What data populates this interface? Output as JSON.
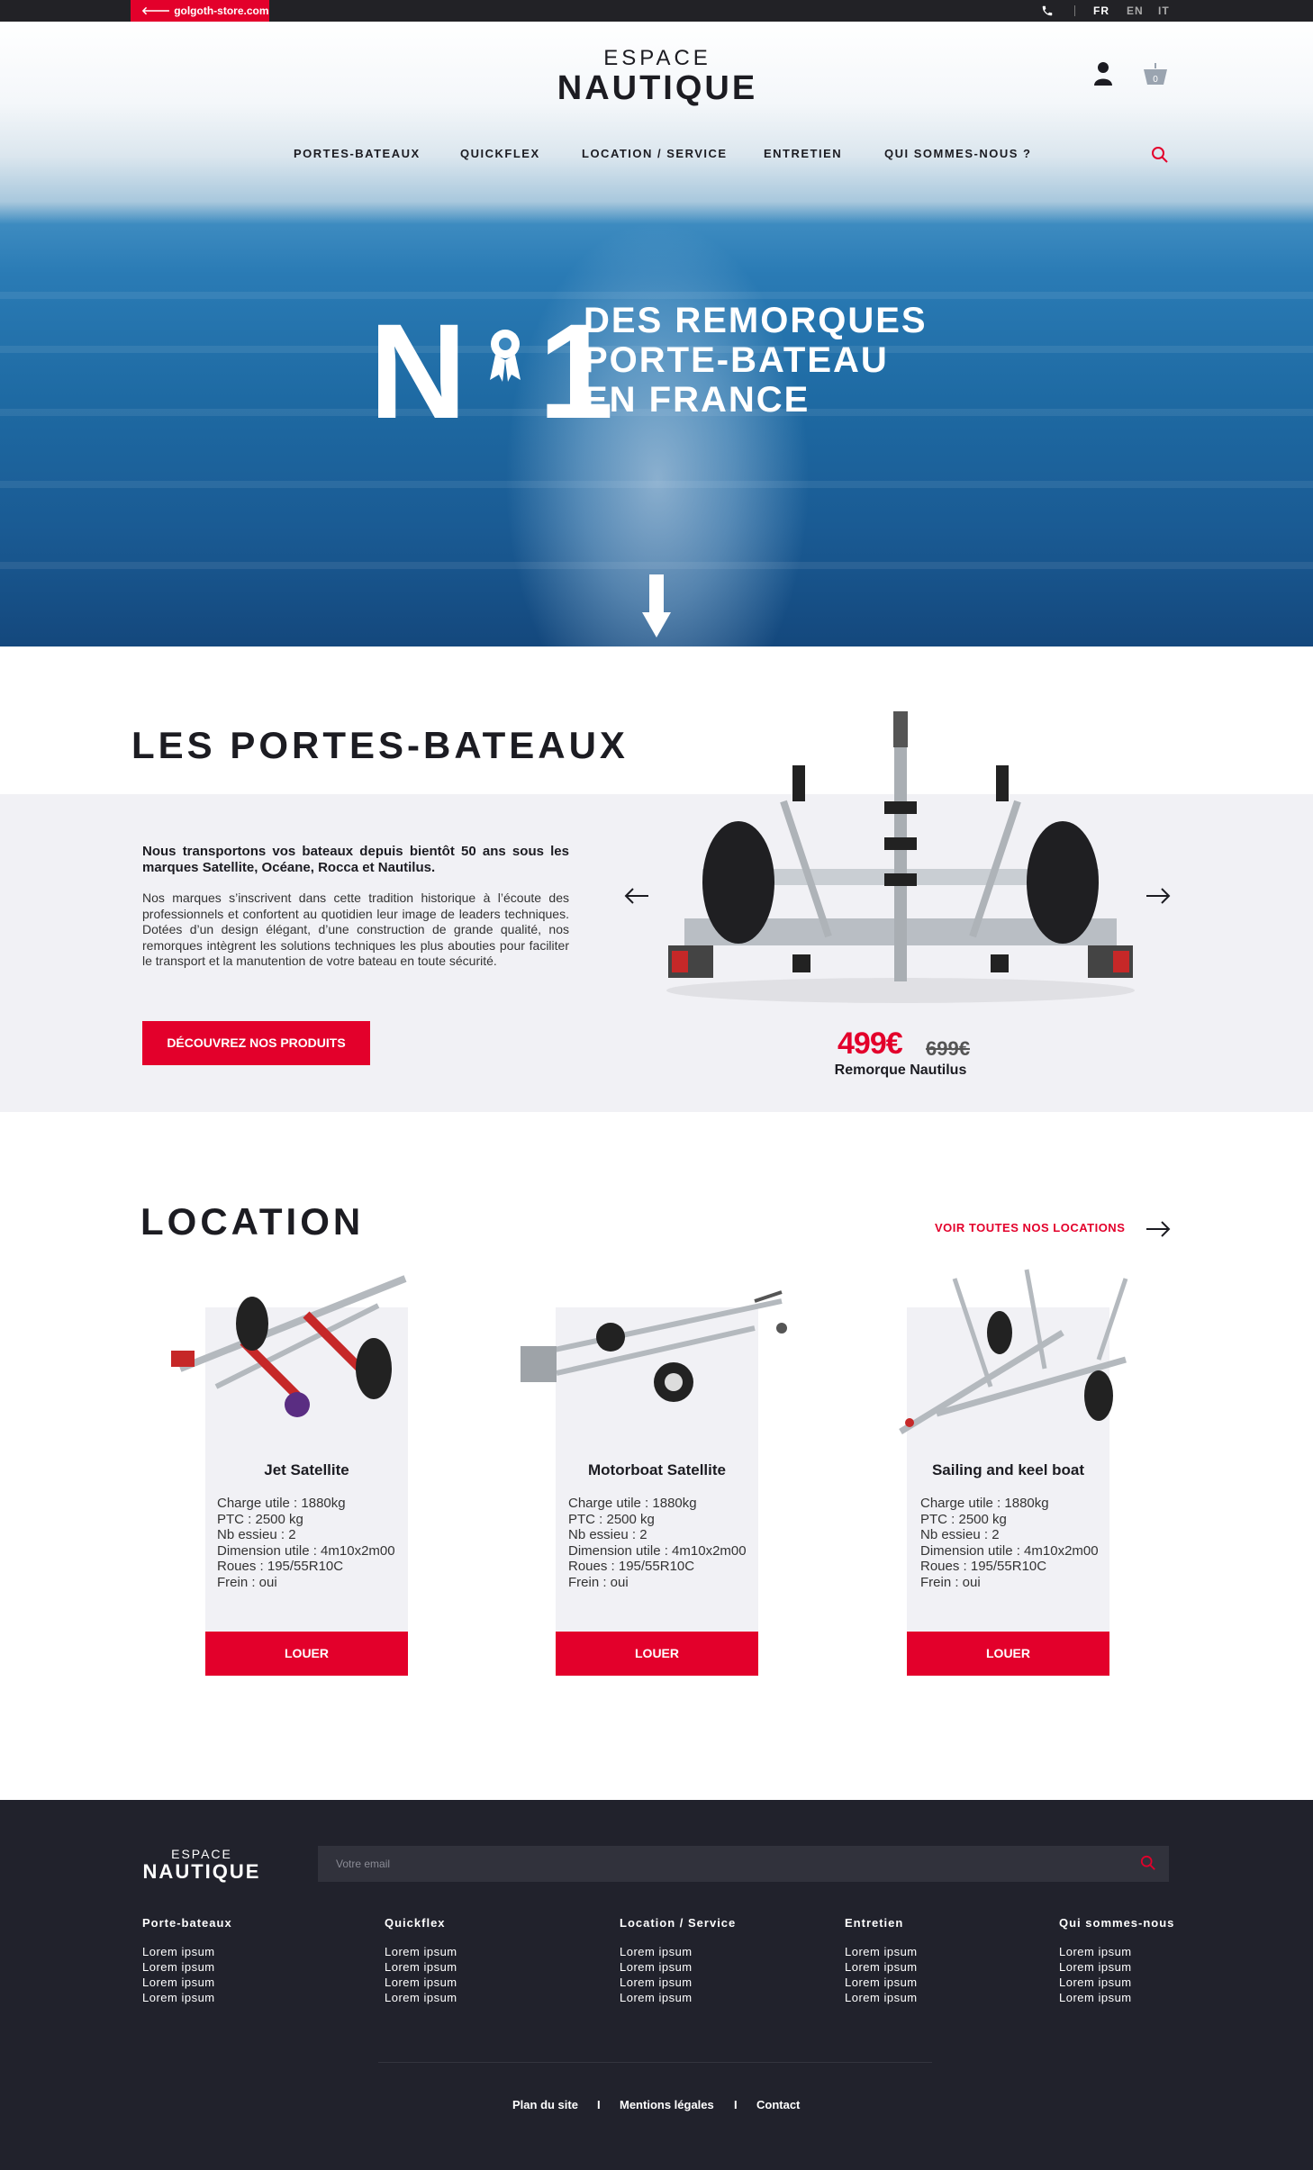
{
  "topbar": {
    "store_link": "golgoth-store.com",
    "languages": [
      "FR",
      "EN",
      "IT"
    ]
  },
  "header": {
    "logo_line1": "ESPACE",
    "logo_line2": "NAUTIQUE",
    "cart_count": "0",
    "nav": [
      "PORTES-BATEAUX",
      "QUICKFLEX",
      "LOCATION / SERVICE",
      "ENTRETIEN",
      "QUI SOMMES-NOUS ?"
    ]
  },
  "hero": {
    "n": "N",
    "o": "o",
    "one": "1",
    "lines": [
      "DES REMORQUES",
      "PORTE-BATEAU",
      "EN FRANCE"
    ]
  },
  "portes_bateaux": {
    "title": "LES PORTES-BATEAUX",
    "lead": "Nous transportons vos bateaux depuis bientôt 50 ans sous les marques Satellite, Océane, Rocca et Nautilus.",
    "body": "Nos marques s’inscrivent dans cette tradition historique à l’écoute des professionnels et confortent au quotidien leur image de leaders techniques. Dotées d’un design élégant, d’une construction de grande qualité, nos remorques intègrent les solutions techniques les plus abouties pour faciliter le transport et la manutention de votre bateau en toute sécurité.",
    "button": "DÉCOUVREZ NOS PRODUITS",
    "product": {
      "price": "499€",
      "old_price": "699€",
      "name": "Remorque Nautilus"
    }
  },
  "location": {
    "title": "LOCATION",
    "see_all": "VOIR TOUTES NOS LOCATIONS",
    "cards": [
      {
        "title": "Jet Satellite",
        "specs": [
          "Charge utile : 1880kg",
          "PTC : 2500 kg",
          "Nb essieu : 2",
          "Dimension utile : 4m10x2m00",
          "Roues : 195/55R10C",
          "Frein : oui"
        ],
        "button": "LOUER"
      },
      {
        "title": "Motorboat Satellite",
        "specs": [
          "Charge utile : 1880kg",
          "PTC : 2500 kg",
          "Nb essieu : 2",
          "Dimension utile : 4m10x2m00",
          "Roues : 195/55R10C",
          "Frein : oui"
        ],
        "button": "LOUER"
      },
      {
        "title": "Sailing and keel boat",
        "specs": [
          "Charge utile : 1880kg",
          "PTC : 2500 kg",
          "Nb essieu : 2",
          "Dimension utile : 4m10x2m00",
          "Roues : 195/55R10C",
          "Frein : oui"
        ],
        "button": "LOUER"
      }
    ]
  },
  "footer": {
    "logo_line1": "ESPACE",
    "logo_line2": "NAUTIQUE",
    "email_placeholder": "Votre email",
    "columns": [
      {
        "heading": "Porte-bateaux",
        "items": [
          "Lorem ipsum",
          "Lorem ipsum",
          "Lorem ipsum",
          "Lorem ipsum"
        ]
      },
      {
        "heading": "Quickflex",
        "items": [
          "Lorem ipsum",
          "Lorem ipsum",
          "Lorem ipsum",
          "Lorem ipsum"
        ]
      },
      {
        "heading": "Location / Service",
        "items": [
          "Lorem ipsum",
          "Lorem ipsum",
          "Lorem ipsum",
          "Lorem ipsum"
        ]
      },
      {
        "heading": "Entretien",
        "items": [
          "Lorem ipsum",
          "Lorem ipsum",
          "Lorem ipsum",
          "Lorem ipsum"
        ]
      },
      {
        "heading": "Qui sommes-nous",
        "items": [
          "Lorem ipsum",
          "Lorem ipsum",
          "Lorem ipsum",
          "Lorem ipsum"
        ]
      }
    ],
    "links": [
      "Plan du site",
      "Mentions légales",
      "Contact"
    ],
    "separator": "I"
  },
  "colors": {
    "accent": "#e3002b",
    "dark": "#21222c",
    "band": "#f1f1f5",
    "text": "#1c1c22"
  },
  "icons": [
    "phone-icon",
    "user-icon",
    "cart-icon",
    "search-icon",
    "arrow-left-icon",
    "arrow-right-icon",
    "scroll-down-arrow-icon"
  ]
}
